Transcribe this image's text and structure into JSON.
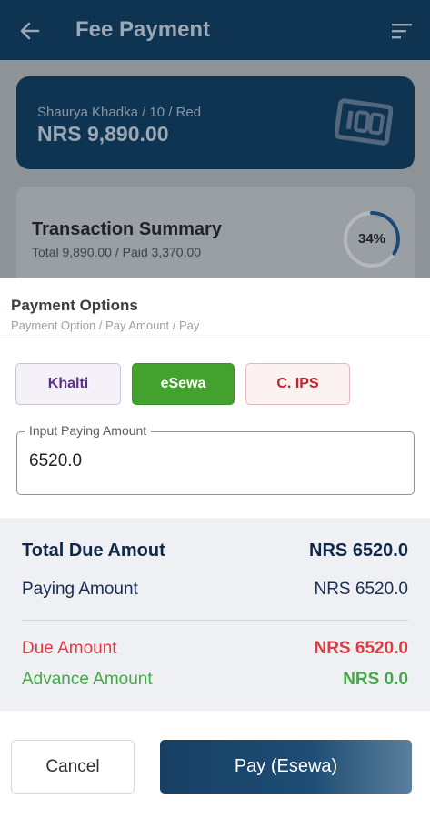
{
  "appbar": {
    "title": "Fee Payment"
  },
  "student": {
    "info": "Shaurya Khadka / 10 / Red",
    "amount": "NRS 9,890.00"
  },
  "transaction": {
    "title": "Transaction Summary",
    "detail": "Total 9,890.00 / Paid 3,370.00",
    "percent_label": "34%",
    "percent": 34
  },
  "sheet": {
    "title": "Payment Options",
    "breadcrumb": "Payment Option / Pay Amount / Pay",
    "options": [
      {
        "label": "Khalti"
      },
      {
        "label": "eSewa"
      },
      {
        "label": "C. IPS"
      }
    ],
    "selected_option": "eSewa",
    "amount_field": {
      "label": "Input Paying Amount",
      "value": "6520.0"
    },
    "summary": {
      "total_due_label": "Total Due Amout",
      "total_due_value": "NRS 6520.0",
      "paying_label": "Paying Amount",
      "paying_value": "NRS 6520.0",
      "due_label": "Due Amount",
      "due_value": "NRS 6520.0",
      "advance_label": "Advance Amount",
      "advance_value": "NRS 0.0"
    },
    "cancel_label": "Cancel",
    "pay_label": "Pay (Esewa)"
  },
  "colors": {
    "primary": "#0f3451",
    "esewa_green": "#43a22d",
    "due_red": "#e33a42",
    "advance_green": "#43a947",
    "khalti_purple": "#5b2d8e",
    "cips_red": "#c2232a"
  },
  "icons": {
    "back": "arrow-left-icon",
    "menu": "sort-menu-icon",
    "badge": "id-badge-icon"
  }
}
